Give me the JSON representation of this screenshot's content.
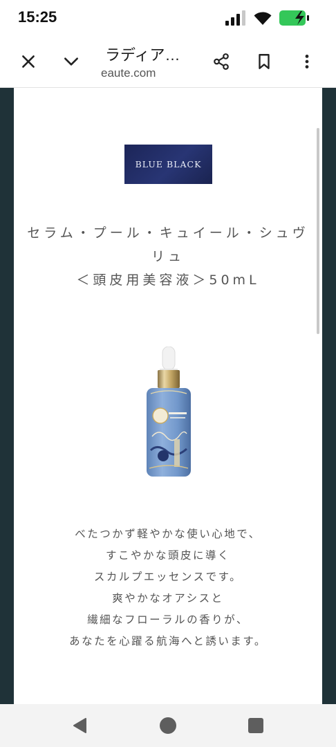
{
  "status_bar": {
    "time": "15:25",
    "icons": [
      "signal-icon",
      "wifi-icon",
      "battery-charging-icon"
    ],
    "battery_color": "#34c759"
  },
  "browser": {
    "title": "ラディア…",
    "url": "eaute.com",
    "icons": [
      "close-icon",
      "chevron-down-icon",
      "share-icon",
      "bookmark-icon",
      "more-vert-icon"
    ]
  },
  "page": {
    "badge_label": "BLUE BLACK",
    "product_name_lines": [
      "セラム・プール・キュイール・シュヴ",
      "リュ",
      "＜頭皮用美容液＞50mL"
    ],
    "description_lines": [
      "べたつかず軽やかな使い心地で、",
      "すこやかな頭皮に導く",
      "スカルプエッセンスです。",
      "爽やかなオアシスと",
      "繊細なフローラルの香りが、",
      "あなたを心躍る航海へと誘います。"
    ],
    "bottle_image": "product-bottle",
    "frame_color": "#1f3238",
    "badge_color": "#202a60"
  },
  "nav": {
    "icons": [
      "back-icon",
      "home-icon",
      "recents-icon"
    ]
  }
}
